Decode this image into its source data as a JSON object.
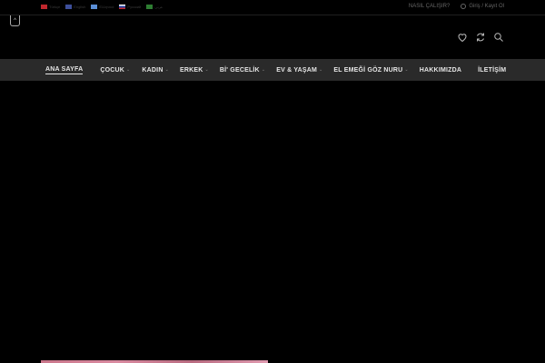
{
  "topbar": {
    "languages": [
      {
        "label": "Türkçe",
        "flag_color": "#c0272d"
      },
      {
        "label": "English",
        "flag_color": "#3d4f9a"
      },
      {
        "label": "Ελληνικά",
        "flag_color": "#5b8fd6"
      },
      {
        "label": "Русский",
        "flag_color": "#d6d6e6"
      },
      {
        "label": "عربي",
        "flag_color": "#2e7d32"
      }
    ],
    "how_it_works": "NASIL ÇALIŞIR?",
    "login": "Giriş / Kayıt Ol"
  },
  "scroll_top": "^",
  "header": {
    "icons": [
      "heart-icon",
      "compare-icon",
      "search-icon"
    ]
  },
  "nav": {
    "items": [
      {
        "label": "ANA SAYFA",
        "active": true,
        "dropdown": false
      },
      {
        "label": "ÇOCUK",
        "active": false,
        "dropdown": true
      },
      {
        "label": "KADIN",
        "active": false,
        "dropdown": true
      },
      {
        "label": "ERKEK",
        "active": false,
        "dropdown": true
      },
      {
        "label": "Bİ' GECELİK",
        "active": false,
        "dropdown": true
      },
      {
        "label": "EV & YAŞAM",
        "active": false,
        "dropdown": true
      },
      {
        "label": "EL EMEĞİ GÖZ NURU",
        "active": false,
        "dropdown": true
      },
      {
        "label": "HAKKIMIZDA",
        "active": false,
        "dropdown": false
      },
      {
        "label": "İLETİŞİM",
        "active": false,
        "dropdown": false
      }
    ],
    "chevron": "⌄"
  },
  "colors": {
    "background": "#000000",
    "nav_bar": "#2a2a2a",
    "nav_text": "#e6e6e6"
  }
}
